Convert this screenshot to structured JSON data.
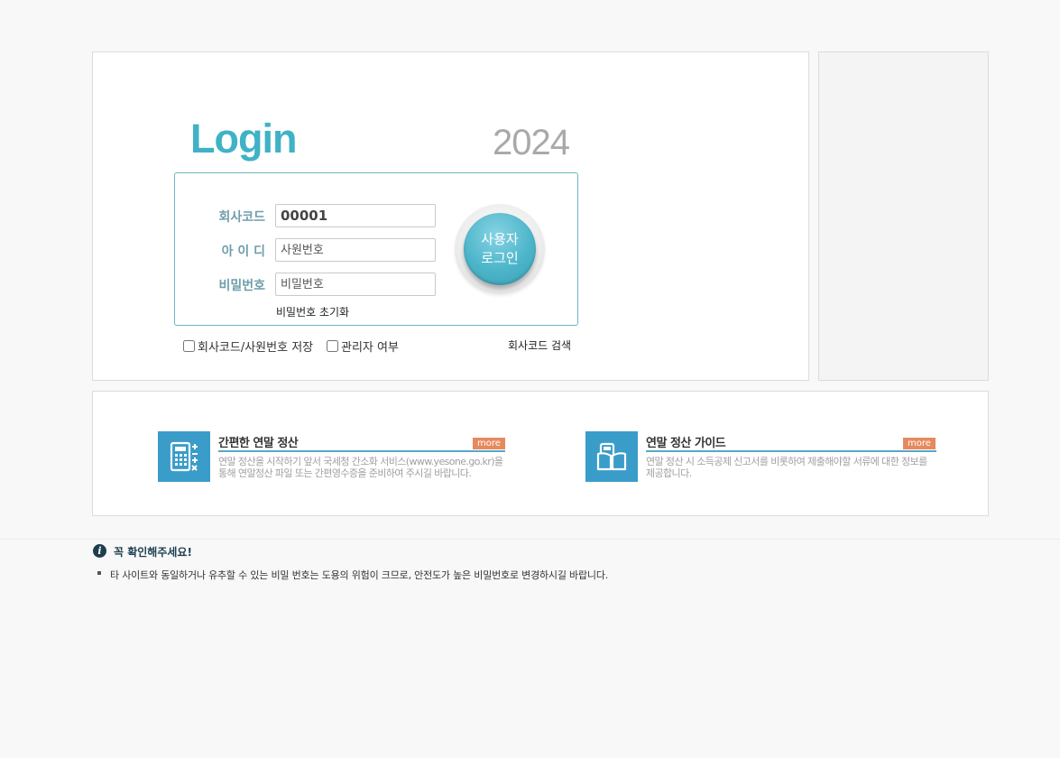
{
  "login": {
    "title": "Login",
    "year": "2024",
    "company_code_label": "회사코드",
    "company_code_value": "00001",
    "id_label": "아 이 디",
    "id_placeholder": "사원번호",
    "password_label": "비밀번호",
    "password_placeholder": "비밀번호",
    "reset_password": "비밀번호 초기화",
    "login_button_line1": "사용자",
    "login_button_line2": "로그인",
    "save_code_label": "회사코드/사원번호 저장",
    "admin_label": "관리자 여부",
    "company_search": "회사코드 검색"
  },
  "cards": [
    {
      "icon": "calculator-icon",
      "title": "간편한 연말 정산",
      "more": "more",
      "desc": "연말 정산을 시작하기 앞서 국세청 간소화 서비스(www.yesone.go.kr)을 통해 연말정산 파일 또는 간편영수증을 준비하여 주시길 바랍니다."
    },
    {
      "icon": "guide-book-icon",
      "title": "연말 정산 가이드",
      "more": "more",
      "desc": "연말 정산 시 소득공제 신고서를 비롯하여 제출해야할 서류에 대한 정보를 제공합니다."
    }
  ],
  "notice": {
    "title": "꼭 확인해주세요!",
    "items": [
      "타 사이트와 동일하거나 유추할 수 있는 비밀 번호는 도용의 위험이 크므로, 안전도가 높은 비밀번호로 변경하시길 바랍니다."
    ]
  },
  "colors": {
    "accent": "#3fb2c6",
    "more": "#e58a5f",
    "icon_bg": "#3a9cc9"
  }
}
